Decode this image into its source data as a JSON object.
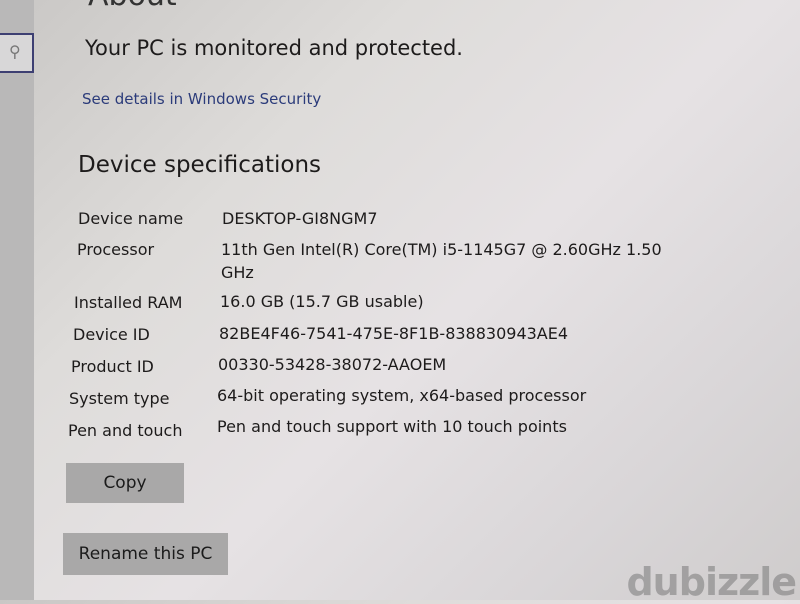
{
  "page": {
    "title": "About",
    "protection_status": "Your PC is monitored and protected.",
    "security_link": "See details in Windows Security",
    "specs_title": "Device specifications",
    "specs": [
      {
        "label": "Device name",
        "value": "DESKTOP-GI8NGM7"
      },
      {
        "label": "Processor",
        "value": "11th Gen Intel(R) Core(TM) i5-1145G7 @ 2.60GHz   1.50",
        "value_cont": "GHz"
      },
      {
        "label": "Installed RAM",
        "value": "16.0 GB (15.7 GB usable)"
      },
      {
        "label": "Device ID",
        "value": "82BE4F46-7541-475E-8F1B-838830943AE4"
      },
      {
        "label": "Product ID",
        "value": "00330-53428-38072-AAOEM"
      },
      {
        "label": "System type",
        "value": "64-bit operating system, x64-based processor"
      },
      {
        "label": "Pen and touch",
        "value": "Pen and touch support with 10 touch points"
      }
    ],
    "copy_label": "Copy",
    "rename_label": "Rename this PC"
  },
  "sidebar": {
    "search_icon": "search-icon"
  },
  "watermark": "dubizzle"
}
